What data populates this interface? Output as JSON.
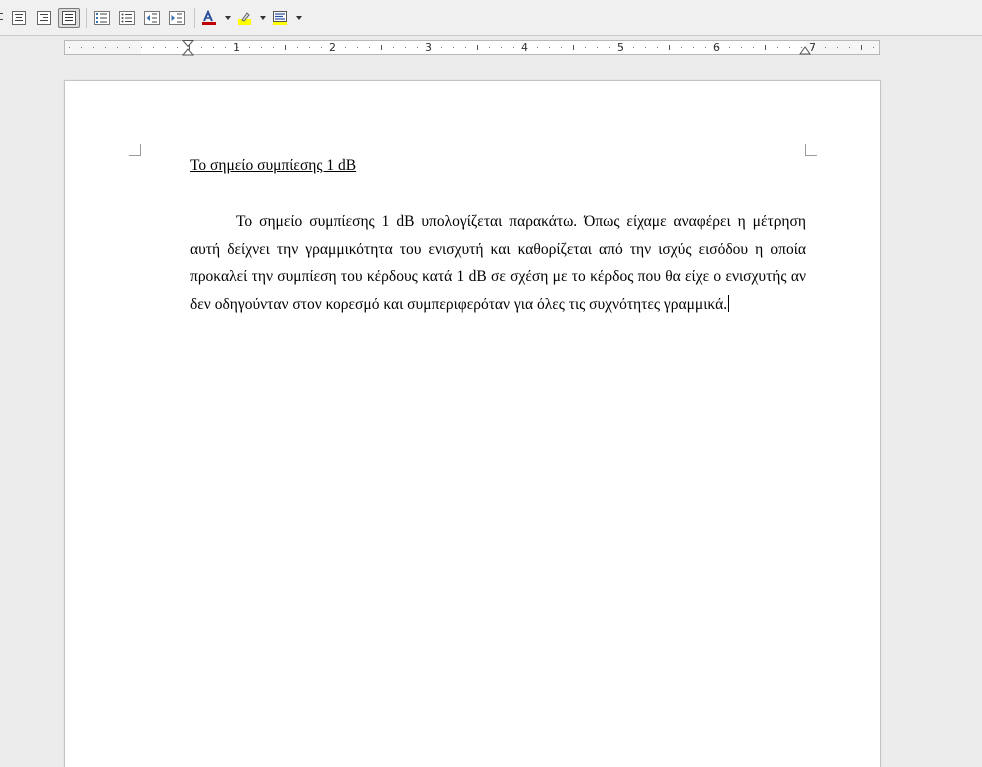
{
  "toolbar": {
    "buttons": [
      {
        "name": "align-center-icon"
      },
      {
        "name": "align-right-icon"
      },
      {
        "name": "align-justify-icon"
      },
      {
        "name": "numbered-list-icon"
      },
      {
        "name": "bulleted-list-icon"
      },
      {
        "name": "decrease-indent-icon"
      },
      {
        "name": "increase-indent-icon"
      },
      {
        "name": "font-color-icon"
      },
      {
        "name": "highlight-icon"
      },
      {
        "name": "background-color-icon"
      }
    ],
    "colors": {
      "font_color": "#c00000",
      "highlight": "#ffff00",
      "background": "#ffff00"
    }
  },
  "ruler": {
    "numbers": [
      "1",
      "2",
      "3",
      "4",
      "5",
      "6",
      "7"
    ]
  },
  "document": {
    "title": "Το σημείο συμπίεσης 1 dB",
    "body": "Το σημείο συμπίεσης 1 dB υπολογίζεται παρακάτω. Όπως είχαμε αναφέρει η μέτρηση αυτή δείχνει την γραμμικότητα του ενισχυτή και καθορίζεται από την ισχύς εισόδου η οποία προκαλεί την συμπίεση του κέρδους κατά 1 dB σε σχέση με το κέρδος που θα είχε ο ενισχυτής αν δεν οδηγούνταν στον κορεσμό και συμπεριφερόταν για όλες τις συχνότητες γραμμικά."
  }
}
